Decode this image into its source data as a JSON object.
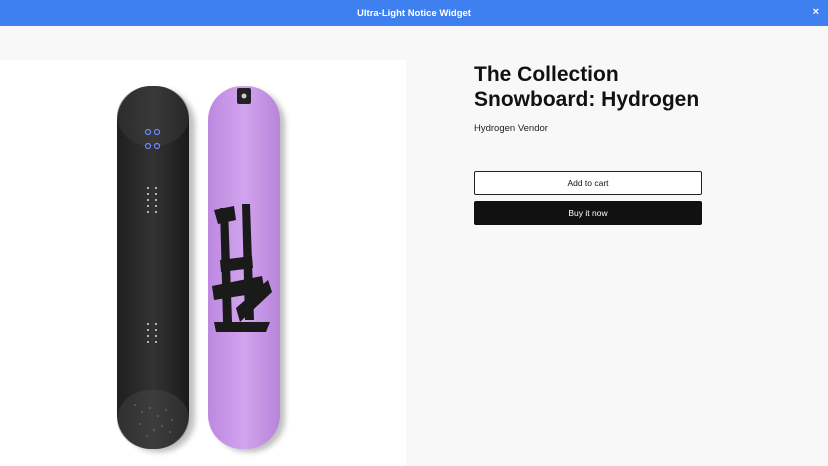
{
  "notice": {
    "text": "Ultra-Light Notice Widget",
    "close_icon": "close-icon",
    "close_glyph": "×",
    "background": "#3f80f0"
  },
  "product": {
    "title": "The Collection Snowboard: Hydrogen",
    "vendor": "Hydrogen Vendor",
    "image_text": "H2",
    "board_colors": {
      "dark": "#2a2a2a",
      "purple": "#c99ae6"
    }
  },
  "actions": {
    "add_to_cart": "Add to cart",
    "buy_now": "Buy it now"
  }
}
